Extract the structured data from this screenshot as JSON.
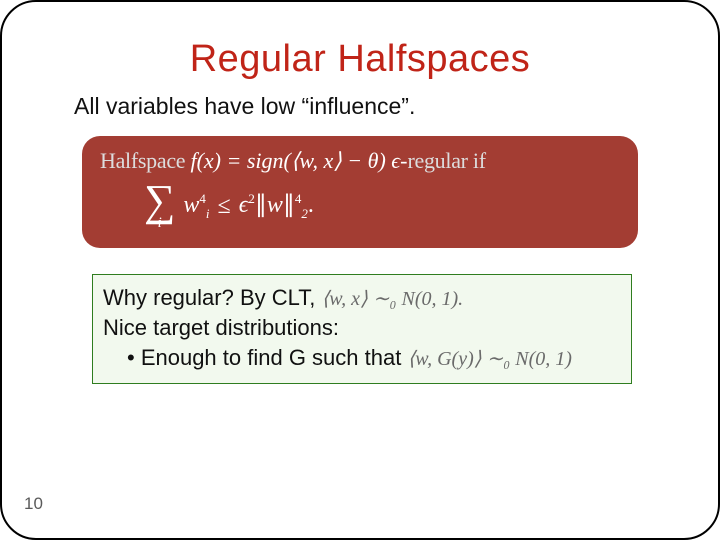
{
  "title": "Regular Halfspaces",
  "subtitle": "All variables have low “influence”.",
  "def": {
    "lead": "Halfspace ",
    "fx": "f(x) = sign(⟨w, x⟩ − θ)",
    "trail_eps": " ϵ-",
    "trail_txt": "regular if",
    "sum_sub": "i",
    "lhs_base": "w",
    "lhs_sub": "i",
    "lhs_sup": "4",
    "leq": "≤",
    "eps2": "ϵ",
    "eps2_sup": "2",
    "norm_open": "∥",
    "norm_w": "w",
    "norm_close": "∥",
    "norm_sub": "2",
    "norm_sup": "4",
    "dot": "."
  },
  "green": {
    "l1a": "Why regular? By CLT, ",
    "l1m": "⟨w, x⟩ ∼₀ N(0, 1).",
    "l2": "Nice target distributions:",
    "l3a": "• Enough to find G such that ",
    "l3m": "⟨w, G(y)⟩ ∼₀ N(0, 1)"
  },
  "page": "10"
}
